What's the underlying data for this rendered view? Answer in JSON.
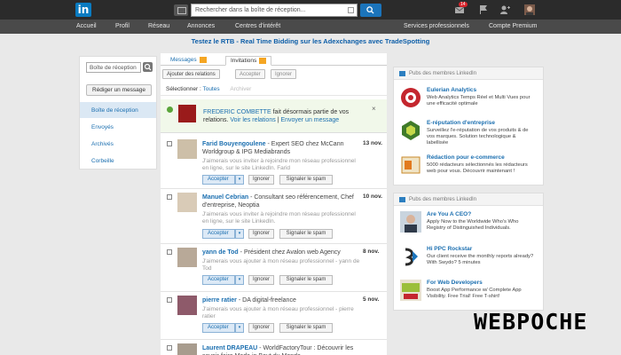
{
  "topbar": {
    "logo_text": "in",
    "search_placeholder": "Rechercher dans la boîte de réception...",
    "notification_count": "14"
  },
  "nav": {
    "items": [
      "Accueil",
      "Profil",
      "Réseau",
      "Annonces",
      "Centres d'intérêt",
      "Services professionnels",
      "Compte Premium"
    ]
  },
  "promo": {
    "text": "Testez le RTB - Real Time Bidding sur les Adexchanges avec TradeSpotting"
  },
  "leftcol": {
    "search_placeholder": "Boîte de réception",
    "compose_label": "Rédiger un message",
    "folders": [
      "Boîte de réception",
      "Envoyés",
      "Archivés",
      "Corbeille"
    ]
  },
  "tabs": {
    "messages": "Messages",
    "invitations": "Invitations"
  },
  "actions": {
    "add": "Ajouter des relations",
    "accept": "Accepter",
    "ignore": "Ignorer"
  },
  "select_row": {
    "prefix": "Sélectionner :",
    "all": "Toutes",
    "archive": "Archiver"
  },
  "notice": {
    "name": "FREDERIC COMBETTE",
    "text1": " fait désormais partie de vos relations.",
    "link1": "Voir les relations",
    "sep": " | ",
    "link2": "Envoyer un message",
    "close": "×"
  },
  "invitations": [
    {
      "name": "Farid Bouyengoulene",
      "title": " - Expert SEO chez McCann Worldgroup & IPG Mediabrands",
      "date": "13 nov.",
      "message": "J'aimerais vous inviter à rejoindre mon réseau professionnel en ligne, sur le site LinkedIn. Farid"
    },
    {
      "name": "Manuel Cebrian",
      "title": " - Consultant seo référencement, Chef d'entreprise, Neoptia",
      "date": "10 nov.",
      "message": "J'aimerais vous inviter à rejoindre mon réseau professionnel en ligne, sur le site LinkedIn."
    },
    {
      "name": "yann de Tod",
      "title": " - Président chez Avalon web Agency",
      "date": "8 nov.",
      "message": "J'aimerais vous ajouter à mon réseau professionnel - yann de Tod"
    },
    {
      "name": "pierre ratier",
      "title": " - DA digital-freelance",
      "date": "5 nov.",
      "message": "J'aimerais vous ajouter à mon réseau professionnel - pierre ratier"
    },
    {
      "name": "Laurent DRAPEAU",
      "title": " - WorldFactoryTour : Découvrir les savoir-faire Made in Bout du Monde",
      "date": "",
      "message": ""
    }
  ],
  "buttons": {
    "accept": "Accepter",
    "caret": "▾",
    "ignore": "Ignorer",
    "spam": "Signaler le spam"
  },
  "ads1": {
    "header": "Pubs des membres LinkedIn",
    "items": [
      {
        "title": "Eulerian Analytics",
        "desc": "Web Analytics Temps Réel et Multi Vues pour une efficacité optimale"
      },
      {
        "title": "E-réputation d'entreprise",
        "desc": "Surveillez l'e-réputation de vos produits & de vos marques. Solution technologique & labellisée"
      },
      {
        "title": "Rédaction pour e-commerce",
        "desc": "5000 rédacteurs sélectionnés les rédacteurs web pour vous. Découvrir maintenant !"
      }
    ]
  },
  "ads2": {
    "header": "Pubs des membres LinkedIn",
    "items": [
      {
        "title": "Are You A CEO?",
        "desc": "Apply Now to the Worldwide Who's Who Registry of Distinguished Individuals."
      },
      {
        "title": "Hi PPC Rockstar",
        "desc": "Our client receive the monthly reports already? With Swydo? 5 minutes"
      },
      {
        "title": "For Web Developers",
        "desc": "Boost App Performance w/ Complete App Visibility. Free Trial! Free T-shirt!"
      }
    ]
  },
  "watermark": "WEBPOCHE",
  "colors": {
    "brand": "#0a7bc1",
    "link": "#1b6fb0",
    "topbar": "#2b2b2b",
    "nav": "#4a4a4a",
    "badge": "#d8232a"
  }
}
